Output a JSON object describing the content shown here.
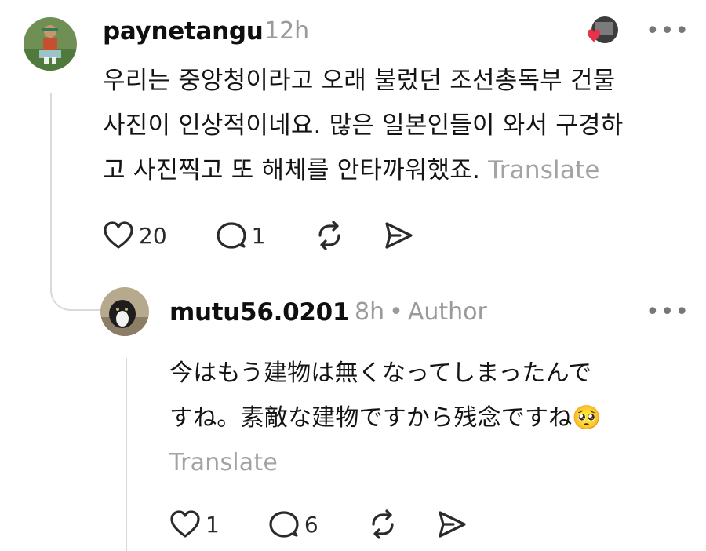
{
  "comments": [
    {
      "username": "paynetangu",
      "time": "12h",
      "text_lines": [
        "우리는 중앙청이라고 오래 불렀던 조선총독부 건물",
        "사진이 인상적이네요. 많은 일본인들이 와서 구경하",
        "고 사진찍고 또 해체를 안타까워했죠."
      ],
      "translate": "Translate",
      "likes": "20",
      "replies": "1"
    },
    {
      "username": "mutu56.0201",
      "time": "8h",
      "badge": "Author",
      "text_lines": [
        "今はもう建物は無くなってしまったんで",
        "すね。素敵な建物ですから残念ですね🥺"
      ],
      "translate": "Translate",
      "likes": "1",
      "replies": "6"
    }
  ],
  "icons": {
    "like": "heart-icon",
    "reply": "speech-bubble-icon",
    "repost": "repost-icon",
    "share": "send-icon",
    "more": "more-dots-icon",
    "liked_by": "liked-by-avatar-heart-icon"
  },
  "colors": {
    "muted": "#9a9a9a",
    "heart": "#e8324a"
  },
  "more_label": "•••"
}
